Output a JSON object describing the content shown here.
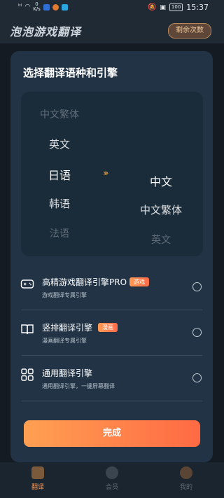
{
  "status_bar": {
    "signal": "ᵢₗ",
    "speed_top": "0",
    "speed_unit": "K/s",
    "battery": "100",
    "time": "15:37"
  },
  "app": {
    "title": "泡泡游戏翻译",
    "quota_button": "剩余次数"
  },
  "sheet": {
    "title": "选择翻译语种和引擎",
    "source_languages": [
      "中文繁体",
      "英文",
      "日语",
      "韩语",
      "法语"
    ],
    "source_selected": "日语",
    "target_languages": [
      "中文",
      "中文繁体",
      "英文"
    ],
    "target_selected": "中文",
    "arrow_glyph": "›››",
    "engines": [
      {
        "name": "高精游戏翻译引擎PRO",
        "tag": "游戏",
        "desc": "游戏翻译专属引擎"
      },
      {
        "name": "竖排翻译引擎",
        "tag": "漫画",
        "desc": "漫画翻译专属引擎"
      },
      {
        "name": "通用翻译引擎",
        "tag": "",
        "desc": "通用翻译引擎，一键屏幕翻译"
      }
    ],
    "done_button": "完成"
  },
  "tabbar": {
    "tabs": [
      {
        "label": "翻译",
        "active": true
      },
      {
        "label": "会员",
        "active": false
      },
      {
        "label": "我的",
        "active": false
      }
    ]
  },
  "colors": {
    "accent": "#ff7a4a",
    "sheet_bg": "#213345",
    "picker_bg": "#1a2b3a"
  }
}
